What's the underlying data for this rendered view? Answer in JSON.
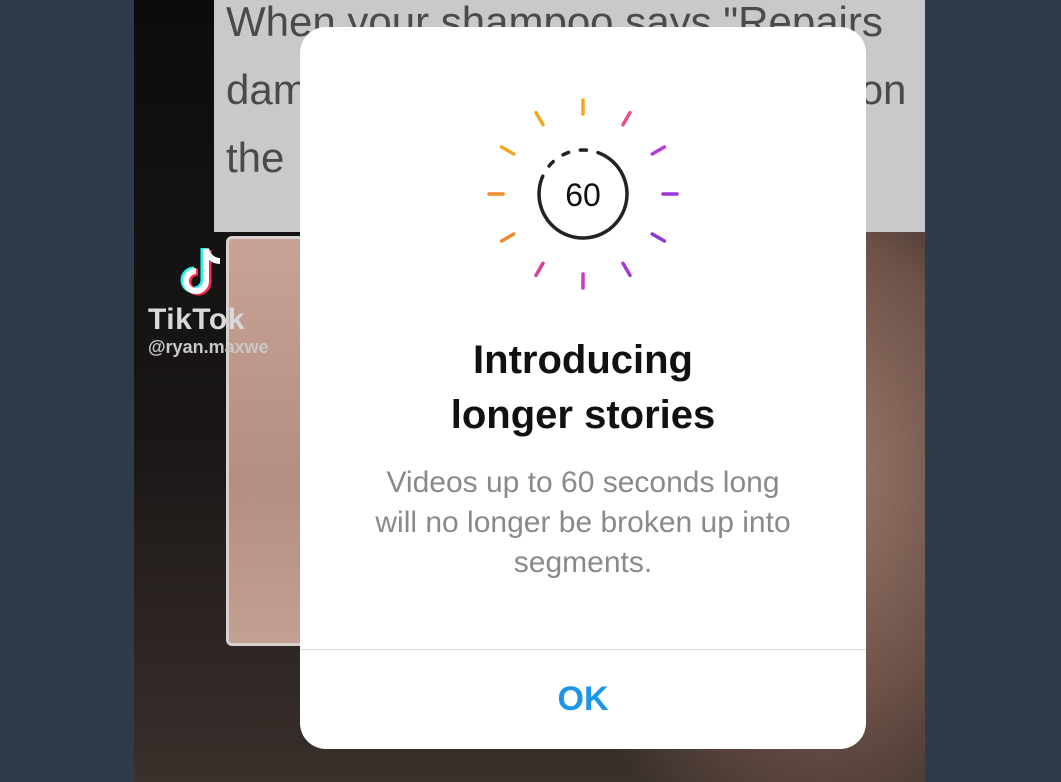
{
  "background_post": {
    "tweet_text_lines": [
      "When your shampoo says \"Repairs",
      "dam",
      "the"
    ],
    "tweet_text_line2_tail": "on",
    "watermark": {
      "brand": "TikTok",
      "handle": "@ryan.maxwe"
    }
  },
  "modal": {
    "badge_number": "60",
    "title": "Introducing\nlonger stories",
    "body": "Videos up to 60 seconds long\nwill no longer be broken up into\nsegments.",
    "ok_label": "OK"
  },
  "colors": {
    "accent": "#1a95e8",
    "ray_colors": [
      "#f5a623",
      "#f28a2e",
      "#e94f7b",
      "#d63ea0",
      "#b43bd1",
      "#8c38d6"
    ]
  },
  "icons": {
    "badge": "sixty-second-timer-icon",
    "watermark": "tiktok-logo-icon"
  }
}
